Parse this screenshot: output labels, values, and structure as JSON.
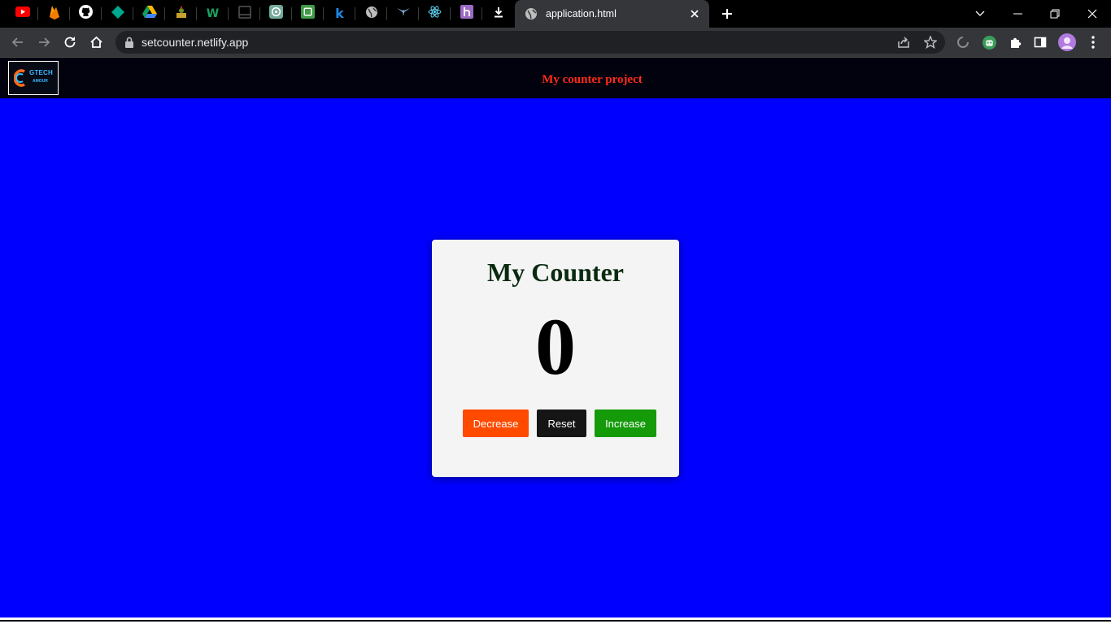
{
  "browser": {
    "pinned_tabs": [
      {
        "icon": "youtube-icon",
        "color": "#ff0000"
      },
      {
        "icon": "firebase-icon",
        "color": "#ffa000"
      },
      {
        "icon": "github-icon",
        "color": "#ffffff"
      },
      {
        "icon": "diamond-icon",
        "color": "#00a88f"
      },
      {
        "icon": "google-drive-icon",
        "color": "#34a853"
      },
      {
        "icon": "site-icon",
        "color": "#c8a030"
      },
      {
        "icon": "w-icon",
        "color": "#1aa260"
      },
      {
        "icon": "window-icon",
        "color": "#555555"
      },
      {
        "icon": "openai-icon",
        "color": "#74aa9c"
      },
      {
        "icon": "sheet-icon",
        "color": "#3f9b45"
      },
      {
        "icon": "k-icon",
        "color": "#1e88e5"
      },
      {
        "icon": "globe-icon",
        "color": "#bdbdbd"
      },
      {
        "icon": "bird-icon",
        "color": "#7fa8d8"
      },
      {
        "icon": "react-icon",
        "color": "#61dafb"
      },
      {
        "icon": "heroku-icon",
        "color": "#9b6bc5"
      },
      {
        "icon": "download-icon",
        "color": "#ffffff"
      }
    ],
    "active_tab": {
      "title": "application.html",
      "icon": "globe-icon"
    },
    "url": "setcounter.netlify.app"
  },
  "site": {
    "logo": {
      "line1": "GTECH",
      "line2": "AMOUR"
    },
    "title": "My counter project"
  },
  "counter_card": {
    "title": "My Counter",
    "value": "0",
    "buttons": {
      "decrease": "Decrease",
      "reset": "Reset",
      "increase": "Increase"
    }
  },
  "colors": {
    "page_background": "#0000ff",
    "header_background": "#02020e",
    "title_color": "#ff2a1a",
    "decrease": "#ff4a00",
    "reset": "#151515",
    "increase": "#159a0a"
  }
}
